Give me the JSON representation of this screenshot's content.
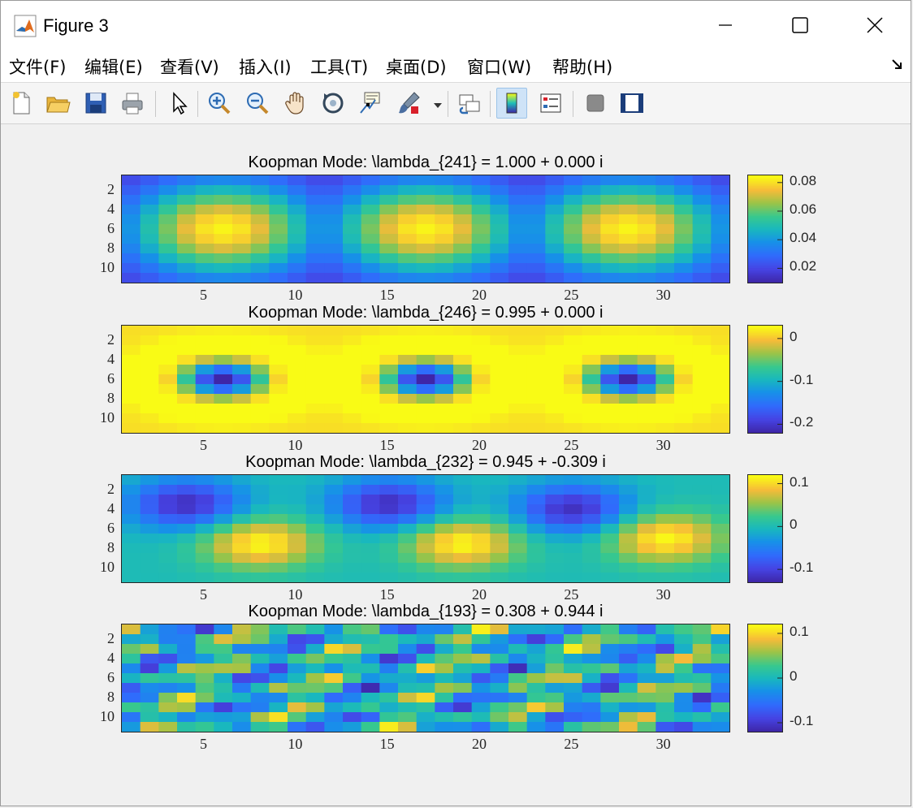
{
  "window": {
    "title": "Figure 3"
  },
  "menu": [
    "文件(F)",
    "编辑(E)",
    "查看(V)",
    "插入(I)",
    "工具(T)",
    "桌面(D)",
    "窗口(W)",
    "帮助(H)"
  ],
  "toolbar": [
    {
      "icon": "new-figure-icon"
    },
    {
      "icon": "open-file-icon"
    },
    {
      "icon": "save-icon"
    },
    {
      "icon": "print-icon"
    },
    {
      "icon": "pointer-icon"
    },
    {
      "icon": "zoom-in-icon"
    },
    {
      "icon": "zoom-out-icon"
    },
    {
      "icon": "pan-icon"
    },
    {
      "icon": "rotate-3d-icon"
    },
    {
      "icon": "data-cursor-icon"
    },
    {
      "icon": "brush-icon"
    },
    {
      "icon": "link-plot-icon"
    },
    {
      "icon": "colorbar-icon"
    },
    {
      "icon": "legend-icon"
    },
    {
      "icon": "hide-plot-tools-icon"
    },
    {
      "icon": "show-plot-tools-icon"
    }
  ],
  "colormap": "parula",
  "chart_data": [
    {
      "type": "heatmap",
      "title": "Koopman Mode: \\lambda_{241} = 1.000 + 0.000 i",
      "x_ticks": [
        "5",
        "10",
        "15",
        "20",
        "25",
        "30"
      ],
      "y_ticks": [
        "2",
        "4",
        "6",
        "8",
        "10"
      ],
      "xlim": [
        0.5,
        33.5
      ],
      "ylim": [
        0.5,
        11.5
      ],
      "clim": [
        0.01,
        0.085
      ],
      "colorbar_ticks": [
        "0.08",
        "0.06",
        "0.04",
        "0.02"
      ],
      "colorbar_values": [
        0.08,
        0.06,
        0.04,
        0.02
      ],
      "pattern": "three bright blobs centred at columns 6, 17, 28"
    },
    {
      "type": "heatmap",
      "title": "Koopman Mode: \\lambda_{246} = 0.995 + 0.000 i",
      "x_ticks": [
        "5",
        "10",
        "15",
        "20",
        "25",
        "30"
      ],
      "y_ticks": [
        "2",
        "4",
        "6",
        "8",
        "10"
      ],
      "xlim": [
        0.5,
        33.5
      ],
      "ylim": [
        0.5,
        11.5
      ],
      "clim": [
        -0.22,
        0.03
      ],
      "colorbar_ticks": [
        "0",
        "-0.1",
        "-0.2"
      ],
      "colorbar_values": [
        0,
        -0.1,
        -0.2
      ],
      "pattern": "three rings with dark centres at columns 6, 17, 28"
    },
    {
      "type": "heatmap",
      "title": "Koopman Mode: \\lambda_{232} = 0.945 + -0.309 i",
      "x_ticks": [
        "5",
        "10",
        "15",
        "20",
        "25",
        "30"
      ],
      "y_ticks": [
        "2",
        "4",
        "6",
        "8",
        "10"
      ],
      "xlim": [
        0.5,
        33.5
      ],
      "ylim": [
        0.5,
        11.5
      ],
      "clim": [
        -0.13,
        0.12
      ],
      "colorbar_ticks": [
        "0.1",
        "0",
        "-0.1"
      ],
      "colorbar_values": [
        0.1,
        0,
        -0.1
      ],
      "pattern": "dipoles: dark near columns 4, 15, 25 rows 3-4; bright near columns 8, 19, 30 rows 7-8"
    },
    {
      "type": "heatmap",
      "title": "Koopman Mode: \\lambda_{193} = 0.308 + 0.944 i",
      "x_ticks": [
        "5",
        "10",
        "15",
        "20",
        "25",
        "30"
      ],
      "y_ticks": [
        "2",
        "4",
        "6",
        "8",
        "10"
      ],
      "xlim": [
        0.5,
        33.5
      ],
      "ylim": [
        0.5,
        11.5
      ],
      "clim": [
        -0.12,
        0.12
      ],
      "colorbar_ticks": [
        "0.1",
        "0",
        "-0.1"
      ],
      "colorbar_values": [
        0.1,
        0,
        -0.1
      ],
      "pattern": "fine checkerboard-like oscillation"
    }
  ]
}
